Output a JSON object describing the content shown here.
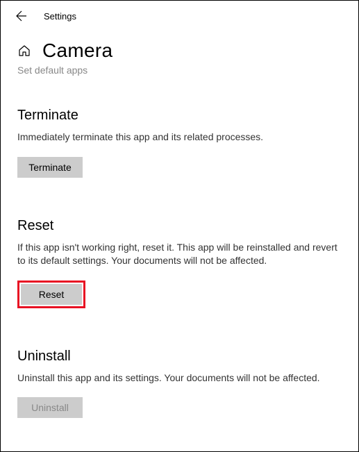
{
  "header": {
    "title": "Settings"
  },
  "page": {
    "title": "Camera",
    "subtitle": "Set default apps"
  },
  "sections": {
    "terminate": {
      "heading": "Terminate",
      "desc": "Immediately terminate this app and its related processes.",
      "button": "Terminate"
    },
    "reset": {
      "heading": "Reset",
      "desc": "If this app isn't working right, reset it. This app will be reinstalled and revert to its default settings. Your documents will not be affected.",
      "button": "Reset"
    },
    "uninstall": {
      "heading": "Uninstall",
      "desc": "Uninstall this app and its settings. Your documents will not be affected.",
      "button": "Uninstall"
    }
  }
}
